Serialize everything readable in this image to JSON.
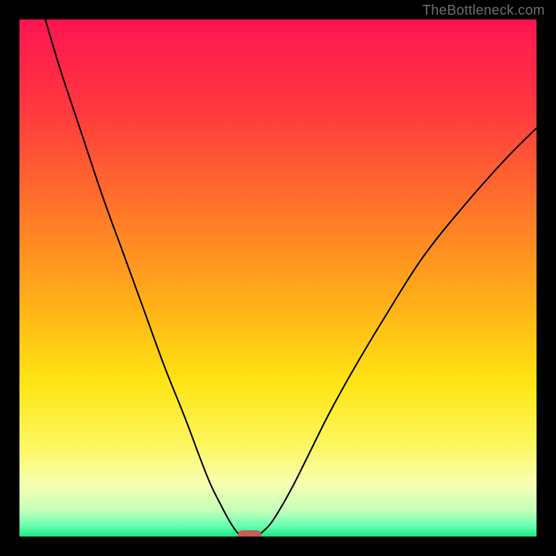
{
  "watermark": "TheBottleneck.com",
  "colors": {
    "frame": "#000000",
    "curve": "#000000",
    "marker": "#c85a5a",
    "gradient_stops": [
      {
        "pct": 0,
        "color": "#ff1452"
      },
      {
        "pct": 18,
        "color": "#ff3a3e"
      },
      {
        "pct": 38,
        "color": "#ff7a27"
      },
      {
        "pct": 55,
        "color": "#ffb018"
      },
      {
        "pct": 70,
        "color": "#ffe413"
      },
      {
        "pct": 82,
        "color": "#fdf65d"
      },
      {
        "pct": 90,
        "color": "#f6ffb2"
      },
      {
        "pct": 95,
        "color": "#c4ffb9"
      },
      {
        "pct": 98,
        "color": "#66ffb0"
      },
      {
        "pct": 100,
        "color": "#18e87e"
      }
    ]
  },
  "chart_data": {
    "type": "line",
    "title": "",
    "xlabel": "",
    "ylabel": "",
    "xlim": [
      0,
      100
    ],
    "ylim": [
      0,
      100
    ],
    "series": [
      {
        "name": "left-arm",
        "x": [
          5,
          8,
          12,
          16,
          20,
          24,
          28,
          32,
          35,
          37,
          39,
          40.5,
          41.5,
          42.3,
          43
        ],
        "y": [
          100,
          90,
          78,
          66,
          55,
          44,
          33,
          23,
          15,
          10,
          6,
          3.2,
          1.6,
          0.6,
          0.1
        ]
      },
      {
        "name": "right-arm",
        "x": [
          46,
          47,
          48.5,
          50.5,
          53,
          56,
          60,
          65,
          71,
          78,
          86,
          94,
          100
        ],
        "y": [
          0.1,
          0.9,
          2.4,
          5.5,
          10,
          16,
          24,
          33,
          43,
          54,
          64,
          73,
          79
        ]
      }
    ],
    "marker": {
      "x": 44.5,
      "y": 0.3
    },
    "notes": "Values estimated from pixels; y=0 at bottom (green), y=100 at top (red)."
  }
}
